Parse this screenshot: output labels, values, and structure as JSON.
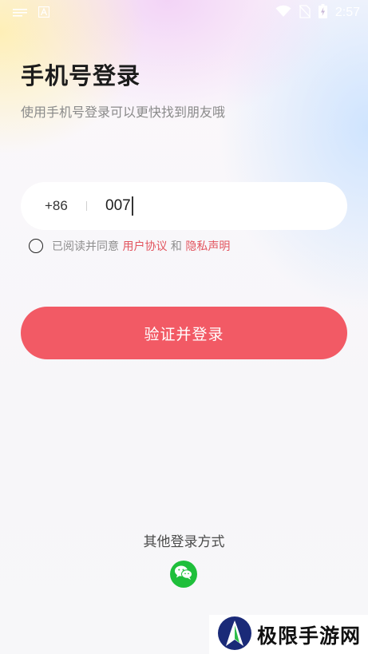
{
  "status_bar": {
    "time": "2:57",
    "icons": [
      "notification-lines-icon",
      "a-letter-icon",
      "wifi-icon",
      "no-sim-icon",
      "battery-charging-icon"
    ]
  },
  "header": {
    "title": "手机号登录",
    "subtitle": "使用手机号登录可以更快找到朋友哦"
  },
  "phone_input": {
    "country_code": "+86",
    "value": "007"
  },
  "agreement": {
    "prefix": "已阅读并同意 ",
    "user_agreement": "用户协议",
    "and": " 和 ",
    "privacy_policy": "隐私声明",
    "checked": false
  },
  "login_button": {
    "label": "验证并登录"
  },
  "other_login": {
    "title": "其他登录方式",
    "options": [
      "wechat-icon"
    ]
  },
  "watermark": {
    "text": "极限手游网"
  },
  "colors": {
    "accent": "#f25a65",
    "link": "#e2545e",
    "wechat": "#1fbf3b"
  }
}
